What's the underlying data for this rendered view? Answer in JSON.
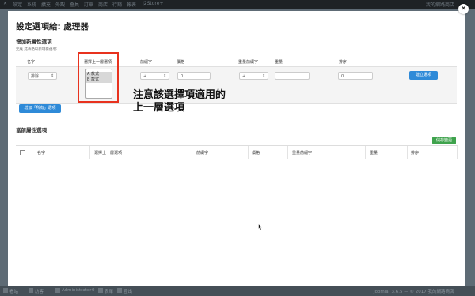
{
  "topbar": {
    "items": [
      "設定",
      "系統",
      "擴充",
      "外觀",
      "會員",
      "訂單",
      "商店",
      "行銷",
      "報表",
      "J2Store+"
    ],
    "right": "我的網路商店"
  },
  "bottombar": {
    "items": [
      "看站",
      "訪客",
      "Administrator",
      "0",
      "表單",
      "登出"
    ],
    "right": "Joomla! 3.6.5 — © 2017 我的網路商店"
  },
  "modal": {
    "title": "設定選項給: 處理器",
    "close_label": "×",
    "add_section": {
      "title": "增加新屬性選項",
      "hint": "完成 此表格以新增新選項:",
      "columns": {
        "name": "名字",
        "parent": "選擇上一層選項",
        "prefix": "前綴字",
        "price": "價格",
        "weight_prefix": "重量前綴字",
        "weight": "重量",
        "order": "排序"
      },
      "name_select": "排除",
      "parent_options": [
        "A 款式",
        "B 款式"
      ],
      "prefix_select": "+",
      "price_value": "0",
      "weight_prefix_select": "+",
      "weight_value": "",
      "order_value": "0",
      "create_button": "建立選項",
      "add_all_button": "增加「所有」選項"
    },
    "annotation": {
      "line1": "注意該選擇項適用的",
      "line2": "上一層選項"
    },
    "current_section": {
      "title": "當前屬性選項",
      "save_button": "儲存變更",
      "headers": [
        "名字",
        "選擇上一層選項",
        "前綴字",
        "價格",
        "重量前綴字",
        "重量",
        "排序"
      ]
    }
  },
  "colors": {
    "highlight": "#e8321e",
    "primary": "#2e8ad8",
    "success": "#3fa34d"
  }
}
